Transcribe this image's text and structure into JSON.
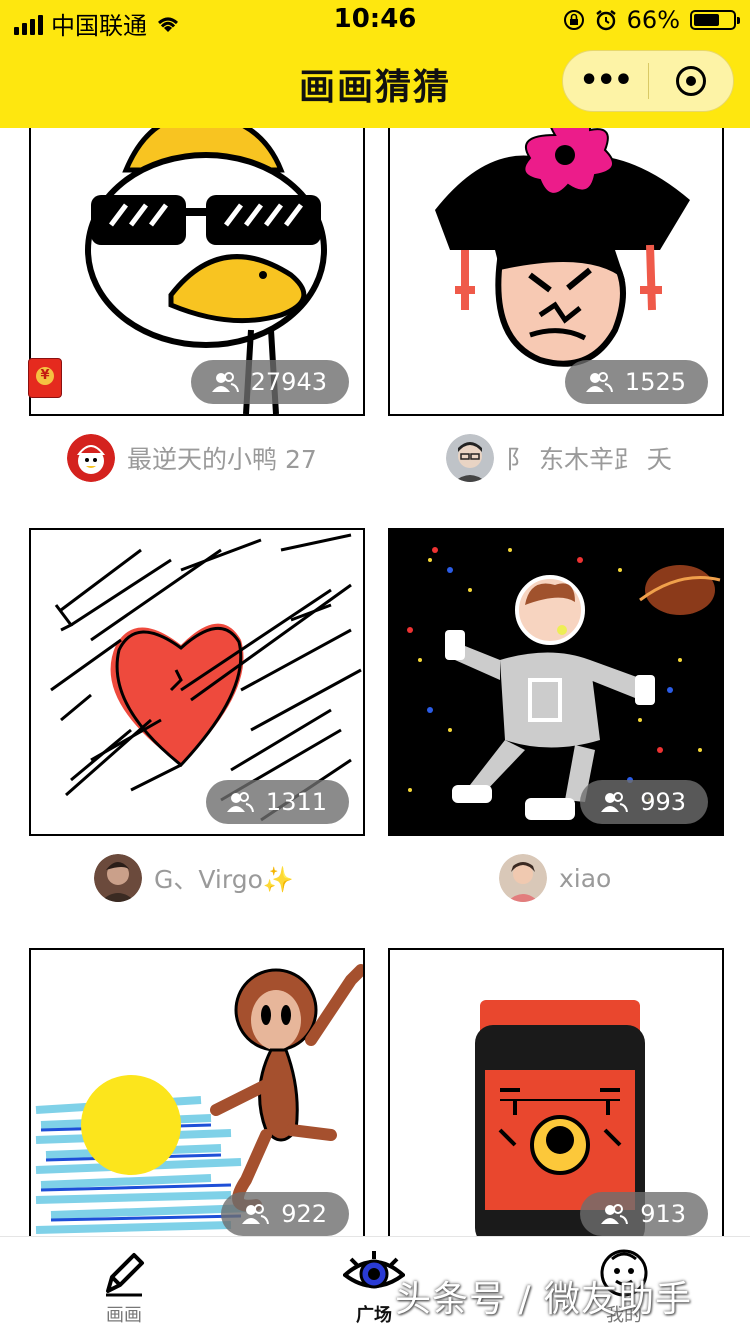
{
  "status_bar": {
    "carrier": "中国联通",
    "time": "10:46",
    "battery_percent": "66%",
    "battery_level": 0.66
  },
  "nav": {
    "title": "画画猜猜",
    "more_label": "•••"
  },
  "cards": [
    {
      "count": "27943",
      "author": "最逆天的小鸭 27",
      "theme": "duck"
    },
    {
      "count": "1525",
      "author": "阝 东木辛𧾷 夭",
      "theme": "girl"
    },
    {
      "count": "1311",
      "author": "G、Virgo✨",
      "theme": "heart"
    },
    {
      "count": "993",
      "author": "xiao",
      "theme": "astronaut"
    },
    {
      "count": "922",
      "author": "",
      "theme": "monkey"
    },
    {
      "count": "913",
      "author": "",
      "theme": "jar"
    }
  ],
  "tabs": [
    {
      "label": "画画",
      "icon": "pencil-icon"
    },
    {
      "label": "广场",
      "icon": "eye-icon"
    },
    {
      "label": "我的",
      "icon": "face-icon"
    }
  ],
  "watermark": "头条号 / 微友助手",
  "colors": {
    "brand_yellow": "#FEE70F",
    "badge_bg": "#6e6e6e",
    "author_text": "#9a9a9a"
  }
}
